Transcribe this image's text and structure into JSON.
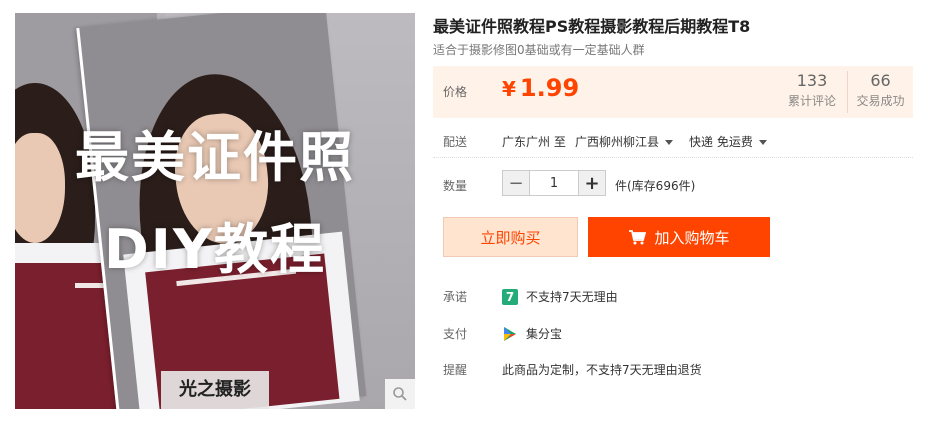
{
  "gallery": {
    "overlay_line1": "最美证件照",
    "overlay_line2": "DIY教程",
    "watermark": "光之摄影",
    "zoom_icon": "magnifier-icon"
  },
  "product": {
    "title": "最美证件照教程PS教程摄影教程后期教程T8",
    "subtitle": "适合于摄影修图0基础或有一定基础人群"
  },
  "price": {
    "label": "价格",
    "currency": "¥",
    "amount": "1.99",
    "color": "#ff4400",
    "reviews_count": "133",
    "reviews_label": "累计评论",
    "trades_count": "66",
    "trades_label": "交易成功"
  },
  "shipping": {
    "label": "配送",
    "from": "广东广州 至",
    "to": "广西柳州柳江县",
    "method": "快递 免运费"
  },
  "quantity": {
    "label": "数量",
    "value": "1",
    "stock": "件(库存696件)"
  },
  "actions": {
    "buy_now": "立即购买",
    "add_to_cart": "加入购物车"
  },
  "promise": {
    "label": "承诺",
    "badge": "7",
    "text": "不支持7天无理由"
  },
  "payment": {
    "label": "支付",
    "icon": "jifenbao-icon",
    "text": "集分宝"
  },
  "reminder": {
    "label": "提醒",
    "text": "此商品为定制，不支持7天无理由退货"
  }
}
